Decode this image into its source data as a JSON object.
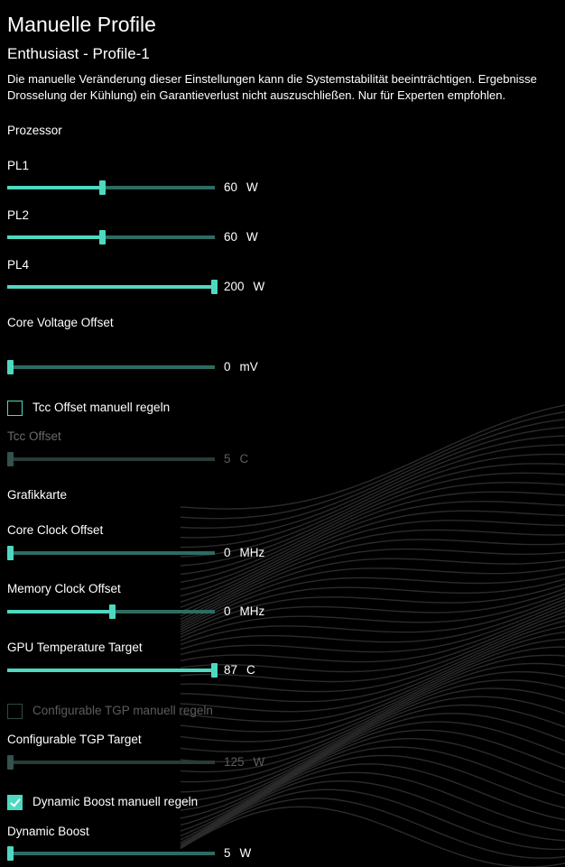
{
  "header": {
    "title": "Manuelle Profile",
    "subtitle": "Enthusiast - Profile-1",
    "description_line1": "Die manuelle Veränderung dieser Einstellungen kann die Systemstabilität beeinträchtigen. Ergebnisse",
    "description_line2": "Drosselung der Kühlung) ein Garantieverlust nicht auszuschließen. Nur für Experten empfohlen."
  },
  "colors": {
    "accent": "#4fd8c0",
    "track": "#2e6c62",
    "background": "#000000",
    "disabled_text": "#5d5d5d"
  },
  "processor": {
    "section_label": "Prozessor",
    "pl1": {
      "label": "PL1",
      "value": "60",
      "unit": "W",
      "level": 0.45,
      "disabled": false
    },
    "pl2": {
      "label": "PL2",
      "value": "60",
      "unit": "W",
      "level": 0.45,
      "disabled": false
    },
    "pl4": {
      "label": "PL4",
      "value": "200",
      "unit": "W",
      "level": 1.0,
      "disabled": false
    },
    "core_voltage": {
      "label": "Core Voltage Offset",
      "value": "0",
      "unit": "mV",
      "level": 0.0,
      "disabled": false
    },
    "tcc_checkbox": {
      "label": "Tcc Offset manuell regeln",
      "checked": false,
      "disabled": false
    },
    "tcc_offset": {
      "label": "Tcc Offset",
      "value": "5",
      "unit": "C",
      "level": 0.0,
      "disabled": true
    }
  },
  "gpu": {
    "section_label": "Grafikkarte",
    "core_clock": {
      "label": "Core Clock Offset",
      "value": "0",
      "unit": "MHz",
      "level": 0.0,
      "disabled": false
    },
    "memory_clock": {
      "label": "Memory Clock Offset",
      "value": "0",
      "unit": "MHz",
      "level": 0.5,
      "disabled": false
    },
    "temp_target": {
      "label": "GPU Temperature Target",
      "value": "87",
      "unit": "C",
      "level": 1.0,
      "disabled": false
    },
    "tgp_checkbox": {
      "label": "Configurable TGP manuell regeln",
      "checked": false,
      "disabled": true
    },
    "tgp_target": {
      "label": "Configurable TGP Target",
      "value": "125",
      "unit": "W",
      "level": 0.0,
      "disabled": true
    },
    "boost_checkbox": {
      "label": "Dynamic Boost manuell regeln",
      "checked": true,
      "disabled": false
    },
    "dynamic_boost": {
      "label": "Dynamic Boost",
      "value": "5",
      "unit": "W",
      "level": 0.0,
      "disabled": false
    }
  }
}
